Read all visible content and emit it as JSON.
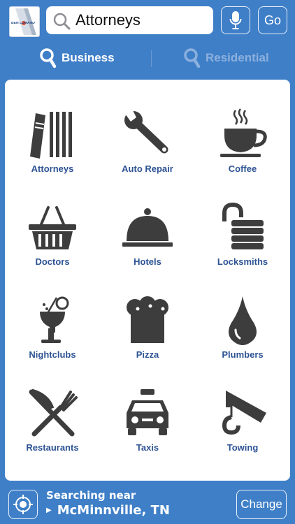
{
  "header": {
    "logo_text": "BEN LOMAND",
    "search_value": "Attorneys",
    "go_label": "Go"
  },
  "tabs": [
    {
      "label": "Business",
      "active": true
    },
    {
      "label": "Residential",
      "active": false
    }
  ],
  "categories": [
    {
      "label": "Attorneys",
      "icon": "books-icon"
    },
    {
      "label": "Auto Repair",
      "icon": "wrench-icon"
    },
    {
      "label": "Coffee",
      "icon": "coffee-cup-icon"
    },
    {
      "label": "Doctors",
      "icon": "basket-icon"
    },
    {
      "label": "Hotels",
      "icon": "cloche-icon"
    },
    {
      "label": "Locksmiths",
      "icon": "padlock-icon"
    },
    {
      "label": "Nightclubs",
      "icon": "cocktail-icon"
    },
    {
      "label": "Pizza",
      "icon": "chef-hat-icon"
    },
    {
      "label": "Plumbers",
      "icon": "water-drop-icon"
    },
    {
      "label": "Restaurants",
      "icon": "knife-fork-icon"
    },
    {
      "label": "Taxis",
      "icon": "taxi-icon"
    },
    {
      "label": "Towing",
      "icon": "tow-hook-icon"
    }
  ],
  "footer": {
    "near_label": "Searching near",
    "city": "McMinnville, TN",
    "change_label": "Change"
  },
  "colors": {
    "brand_blue": "#3f7fc8",
    "icon_gray": "#3d3d3d",
    "label_blue": "#2d5394"
  }
}
